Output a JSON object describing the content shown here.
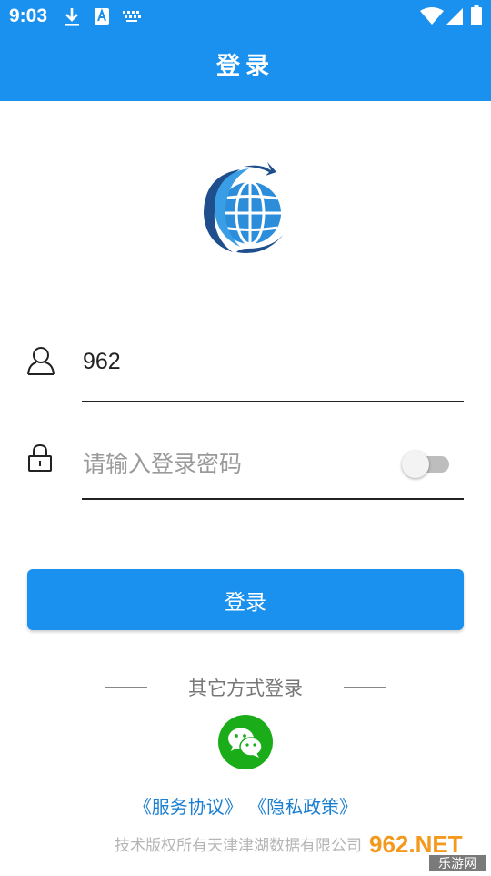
{
  "status_bar": {
    "time": "9:03",
    "icons": [
      "download-icon",
      "font-icon",
      "keyboard-icon",
      "wifi-icon",
      "signal-icon",
      "battery-icon"
    ]
  },
  "header": {
    "title": "登录"
  },
  "colors": {
    "primary": "#1a91ee",
    "wechat": "#1aad19",
    "link": "#1a7fd1"
  },
  "form": {
    "username": {
      "icon": "user-icon",
      "value": "962"
    },
    "password": {
      "icon": "lock-icon",
      "placeholder": "请输入登录密码",
      "show_toggle": false
    },
    "submit_label": "登录"
  },
  "alt_login": {
    "label": "其它方式登录",
    "wechat_icon": "wechat-icon"
  },
  "agreements": {
    "terms": "《服务协议》",
    "privacy": "《隐私政策》"
  },
  "footer": {
    "copyright": "技术版权所有天津津湖数据有限公司"
  },
  "watermark": {
    "brand": "962.NET",
    "sub": "乐游网"
  }
}
